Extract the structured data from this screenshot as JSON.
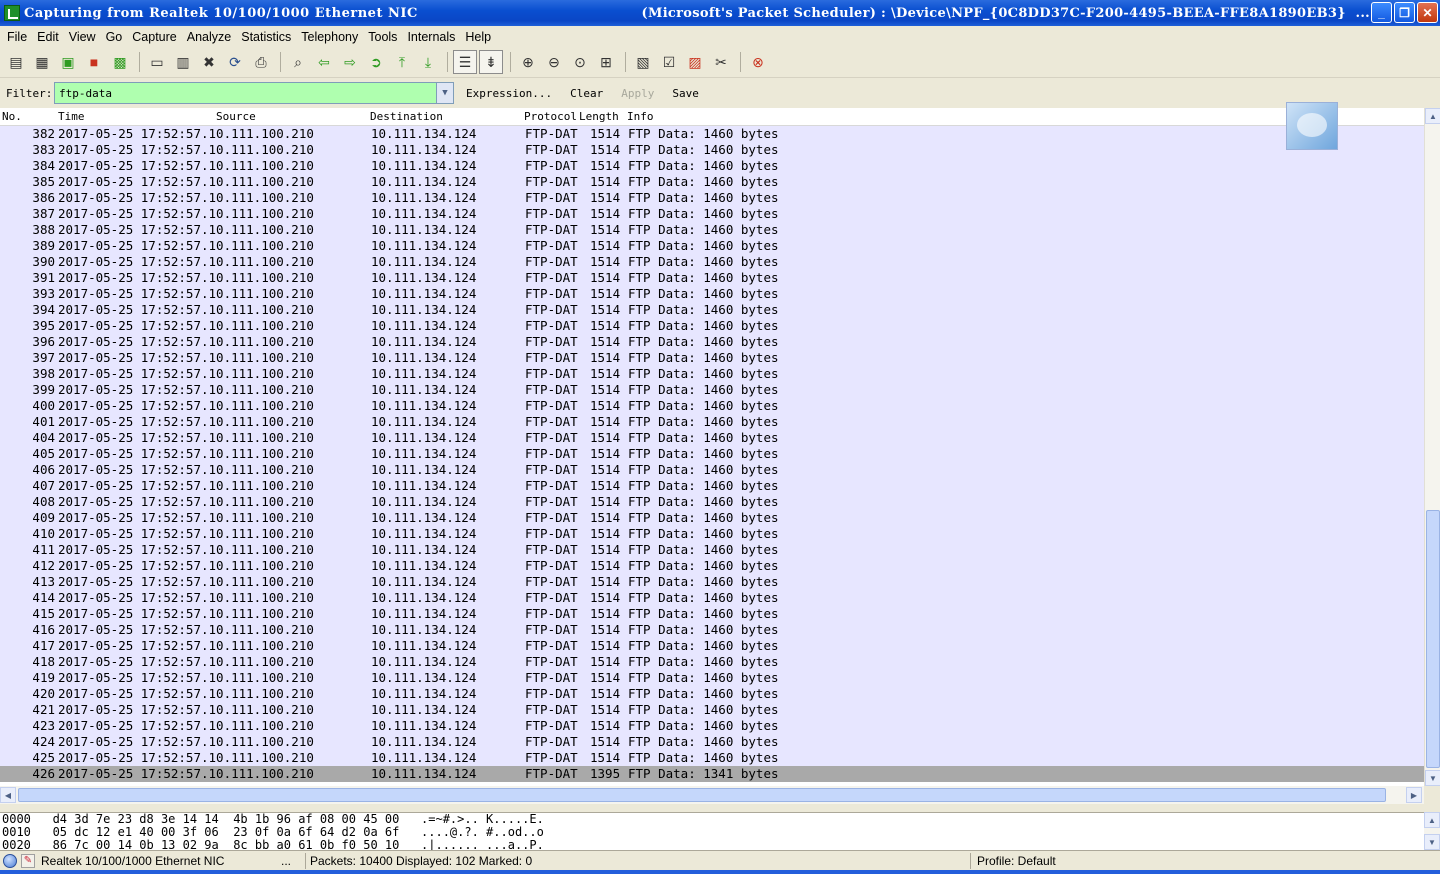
{
  "window": {
    "title": "Capturing from Realtek 10/100/1000 Ethernet NIC",
    "title_right": "(Microsoft's Packet Scheduler) : \\Device\\NPF_{0C8DD37C-F200-4495-BEEA-FFE8A1890EB3}  ...",
    "minimize": "_",
    "maximize": "❐",
    "close": "✕"
  },
  "menu": {
    "file": "File",
    "edit": "Edit",
    "view": "View",
    "go": "Go",
    "capture": "Capture",
    "analyze": "Analyze",
    "statistics": "Statistics",
    "telephony": "Telephony",
    "tools": "Tools",
    "internals": "Internals",
    "help": "Help"
  },
  "filter": {
    "label": "Filter:",
    "value": "ftp-data",
    "expression": "Expression...",
    "clear": "Clear",
    "apply": "Apply",
    "save": "Save"
  },
  "columns": {
    "no": "No.",
    "time": "Time",
    "source": "Source",
    "destination": "Destination",
    "protocol": "Protocol",
    "length": "Length",
    "info": "Info"
  },
  "packets": [
    {
      "no": "382",
      "time": "2017-05-25 17:52:57.10.111.100.210",
      "dst": "10.111.134.124",
      "proto": "FTP-DAT",
      "len": "1514",
      "info": "FTP Data: 1460 bytes"
    },
    {
      "no": "383",
      "time": "2017-05-25 17:52:57.10.111.100.210",
      "dst": "10.111.134.124",
      "proto": "FTP-DAT",
      "len": "1514",
      "info": "FTP Data: 1460 bytes"
    },
    {
      "no": "384",
      "time": "2017-05-25 17:52:57.10.111.100.210",
      "dst": "10.111.134.124",
      "proto": "FTP-DAT",
      "len": "1514",
      "info": "FTP Data: 1460 bytes"
    },
    {
      "no": "385",
      "time": "2017-05-25 17:52:57.10.111.100.210",
      "dst": "10.111.134.124",
      "proto": "FTP-DAT",
      "len": "1514",
      "info": "FTP Data: 1460 bytes"
    },
    {
      "no": "386",
      "time": "2017-05-25 17:52:57.10.111.100.210",
      "dst": "10.111.134.124",
      "proto": "FTP-DAT",
      "len": "1514",
      "info": "FTP Data: 1460 bytes"
    },
    {
      "no": "387",
      "time": "2017-05-25 17:52:57.10.111.100.210",
      "dst": "10.111.134.124",
      "proto": "FTP-DAT",
      "len": "1514",
      "info": "FTP Data: 1460 bytes"
    },
    {
      "no": "388",
      "time": "2017-05-25 17:52:57.10.111.100.210",
      "dst": "10.111.134.124",
      "proto": "FTP-DAT",
      "len": "1514",
      "info": "FTP Data: 1460 bytes"
    },
    {
      "no": "389",
      "time": "2017-05-25 17:52:57.10.111.100.210",
      "dst": "10.111.134.124",
      "proto": "FTP-DAT",
      "len": "1514",
      "info": "FTP Data: 1460 bytes"
    },
    {
      "no": "390",
      "time": "2017-05-25 17:52:57.10.111.100.210",
      "dst": "10.111.134.124",
      "proto": "FTP-DAT",
      "len": "1514",
      "info": "FTP Data: 1460 bytes"
    },
    {
      "no": "391",
      "time": "2017-05-25 17:52:57.10.111.100.210",
      "dst": "10.111.134.124",
      "proto": "FTP-DAT",
      "len": "1514",
      "info": "FTP Data: 1460 bytes"
    },
    {
      "no": "393",
      "time": "2017-05-25 17:52:57.10.111.100.210",
      "dst": "10.111.134.124",
      "proto": "FTP-DAT",
      "len": "1514",
      "info": "FTP Data: 1460 bytes"
    },
    {
      "no": "394",
      "time": "2017-05-25 17:52:57.10.111.100.210",
      "dst": "10.111.134.124",
      "proto": "FTP-DAT",
      "len": "1514",
      "info": "FTP Data: 1460 bytes"
    },
    {
      "no": "395",
      "time": "2017-05-25 17:52:57.10.111.100.210",
      "dst": "10.111.134.124",
      "proto": "FTP-DAT",
      "len": "1514",
      "info": "FTP Data: 1460 bytes"
    },
    {
      "no": "396",
      "time": "2017-05-25 17:52:57.10.111.100.210",
      "dst": "10.111.134.124",
      "proto": "FTP-DAT",
      "len": "1514",
      "info": "FTP Data: 1460 bytes"
    },
    {
      "no": "397",
      "time": "2017-05-25 17:52:57.10.111.100.210",
      "dst": "10.111.134.124",
      "proto": "FTP-DAT",
      "len": "1514",
      "info": "FTP Data: 1460 bytes"
    },
    {
      "no": "398",
      "time": "2017-05-25 17:52:57.10.111.100.210",
      "dst": "10.111.134.124",
      "proto": "FTP-DAT",
      "len": "1514",
      "info": "FTP Data: 1460 bytes"
    },
    {
      "no": "399",
      "time": "2017-05-25 17:52:57.10.111.100.210",
      "dst": "10.111.134.124",
      "proto": "FTP-DAT",
      "len": "1514",
      "info": "FTP Data: 1460 bytes"
    },
    {
      "no": "400",
      "time": "2017-05-25 17:52:57.10.111.100.210",
      "dst": "10.111.134.124",
      "proto": "FTP-DAT",
      "len": "1514",
      "info": "FTP Data: 1460 bytes"
    },
    {
      "no": "401",
      "time": "2017-05-25 17:52:57.10.111.100.210",
      "dst": "10.111.134.124",
      "proto": "FTP-DAT",
      "len": "1514",
      "info": "FTP Data: 1460 bytes"
    },
    {
      "no": "404",
      "time": "2017-05-25 17:52:57.10.111.100.210",
      "dst": "10.111.134.124",
      "proto": "FTP-DAT",
      "len": "1514",
      "info": "FTP Data: 1460 bytes"
    },
    {
      "no": "405",
      "time": "2017-05-25 17:52:57.10.111.100.210",
      "dst": "10.111.134.124",
      "proto": "FTP-DAT",
      "len": "1514",
      "info": "FTP Data: 1460 bytes"
    },
    {
      "no": "406",
      "time": "2017-05-25 17:52:57.10.111.100.210",
      "dst": "10.111.134.124",
      "proto": "FTP-DAT",
      "len": "1514",
      "info": "FTP Data: 1460 bytes"
    },
    {
      "no": "407",
      "time": "2017-05-25 17:52:57.10.111.100.210",
      "dst": "10.111.134.124",
      "proto": "FTP-DAT",
      "len": "1514",
      "info": "FTP Data: 1460 bytes"
    },
    {
      "no": "408",
      "time": "2017-05-25 17:52:57.10.111.100.210",
      "dst": "10.111.134.124",
      "proto": "FTP-DAT",
      "len": "1514",
      "info": "FTP Data: 1460 bytes"
    },
    {
      "no": "409",
      "time": "2017-05-25 17:52:57.10.111.100.210",
      "dst": "10.111.134.124",
      "proto": "FTP-DAT",
      "len": "1514",
      "info": "FTP Data: 1460 bytes"
    },
    {
      "no": "410",
      "time": "2017-05-25 17:52:57.10.111.100.210",
      "dst": "10.111.134.124",
      "proto": "FTP-DAT",
      "len": "1514",
      "info": "FTP Data: 1460 bytes"
    },
    {
      "no": "411",
      "time": "2017-05-25 17:52:57.10.111.100.210",
      "dst": "10.111.134.124",
      "proto": "FTP-DAT",
      "len": "1514",
      "info": "FTP Data: 1460 bytes"
    },
    {
      "no": "412",
      "time": "2017-05-25 17:52:57.10.111.100.210",
      "dst": "10.111.134.124",
      "proto": "FTP-DAT",
      "len": "1514",
      "info": "FTP Data: 1460 bytes"
    },
    {
      "no": "413",
      "time": "2017-05-25 17:52:57.10.111.100.210",
      "dst": "10.111.134.124",
      "proto": "FTP-DAT",
      "len": "1514",
      "info": "FTP Data: 1460 bytes"
    },
    {
      "no": "414",
      "time": "2017-05-25 17:52:57.10.111.100.210",
      "dst": "10.111.134.124",
      "proto": "FTP-DAT",
      "len": "1514",
      "info": "FTP Data: 1460 bytes"
    },
    {
      "no": "415",
      "time": "2017-05-25 17:52:57.10.111.100.210",
      "dst": "10.111.134.124",
      "proto": "FTP-DAT",
      "len": "1514",
      "info": "FTP Data: 1460 bytes"
    },
    {
      "no": "416",
      "time": "2017-05-25 17:52:57.10.111.100.210",
      "dst": "10.111.134.124",
      "proto": "FTP-DAT",
      "len": "1514",
      "info": "FTP Data: 1460 bytes"
    },
    {
      "no": "417",
      "time": "2017-05-25 17:52:57.10.111.100.210",
      "dst": "10.111.134.124",
      "proto": "FTP-DAT",
      "len": "1514",
      "info": "FTP Data: 1460 bytes"
    },
    {
      "no": "418",
      "time": "2017-05-25 17:52:57.10.111.100.210",
      "dst": "10.111.134.124",
      "proto": "FTP-DAT",
      "len": "1514",
      "info": "FTP Data: 1460 bytes"
    },
    {
      "no": "419",
      "time": "2017-05-25 17:52:57.10.111.100.210",
      "dst": "10.111.134.124",
      "proto": "FTP-DAT",
      "len": "1514",
      "info": "FTP Data: 1460 bytes"
    },
    {
      "no": "420",
      "time": "2017-05-25 17:52:57.10.111.100.210",
      "dst": "10.111.134.124",
      "proto": "FTP-DAT",
      "len": "1514",
      "info": "FTP Data: 1460 bytes"
    },
    {
      "no": "421",
      "time": "2017-05-25 17:52:57.10.111.100.210",
      "dst": "10.111.134.124",
      "proto": "FTP-DAT",
      "len": "1514",
      "info": "FTP Data: 1460 bytes"
    },
    {
      "no": "423",
      "time": "2017-05-25 17:52:57.10.111.100.210",
      "dst": "10.111.134.124",
      "proto": "FTP-DAT",
      "len": "1514",
      "info": "FTP Data: 1460 bytes"
    },
    {
      "no": "424",
      "time": "2017-05-25 17:52:57.10.111.100.210",
      "dst": "10.111.134.124",
      "proto": "FTP-DAT",
      "len": "1514",
      "info": "FTP Data: 1460 bytes"
    },
    {
      "no": "425",
      "time": "2017-05-25 17:52:57.10.111.100.210",
      "dst": "10.111.134.124",
      "proto": "FTP-DAT",
      "len": "1514",
      "info": "FTP Data: 1460 bytes"
    },
    {
      "no": "426",
      "time": "2017-05-25 17:52:57.10.111.100.210",
      "dst": "10.111.134.124",
      "proto": "FTP-DAT",
      "len": "1395",
      "info": "FTP Data: 1341 bytes",
      "selected": true
    }
  ],
  "hex": [
    "0000   d4 3d 7e 23 d8 3e 14 14  4b 1b 96 af 08 00 45 00   .=~#.>.. K.....E.",
    "0010   05 dc 12 e1 40 00 3f 06  23 0f 0a 6f 64 d2 0a 6f   ....@.?. #..od..o",
    "0020   86 7c 00 14 0b 13 02 9a  8c bb a0 61 0b f0 50 10   .|...... ...a..P."
  ],
  "status": {
    "interface": "Realtek 10/100/1000 Ethernet NIC",
    "ellipsis": "...",
    "packets": "Packets: 10400 Displayed: 102 Marked: 0",
    "profile": "Profile: Default"
  },
  "colors": {
    "row_bg": "#e7e6ff",
    "selected_row_bg": "#a9a9a9",
    "filter_valid_bg": "#afffaf",
    "titlebar": "#0a46c6"
  }
}
